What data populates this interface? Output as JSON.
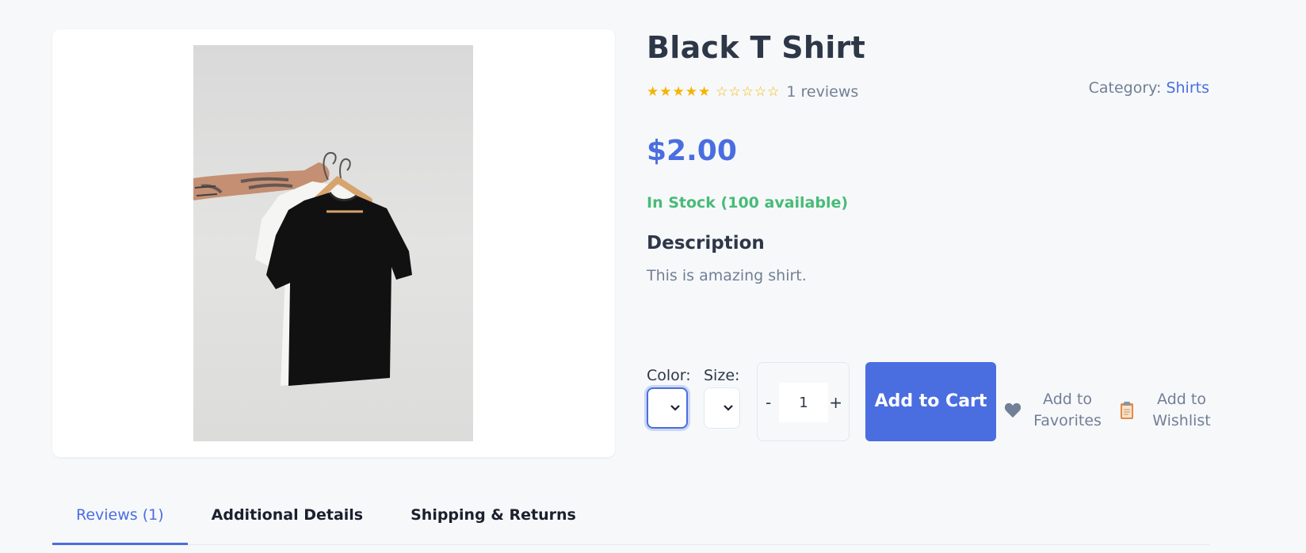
{
  "product": {
    "title": "Black T Shirt",
    "stars_filled": "★★★★★",
    "stars_empty": "☆☆☆☆☆",
    "rating_value": 5,
    "rating_max": 10,
    "reviews_text": "1 reviews",
    "category_label": "Category:",
    "category_value": "Shirts",
    "price": "$2.00",
    "stock": "In Stock (100 available)",
    "description_heading": "Description",
    "description": "This is amazing shirt."
  },
  "options": {
    "color_label": "Color:",
    "size_label": "Size:",
    "quantity_minus": "-",
    "quantity_value": "1",
    "quantity_plus": "+"
  },
  "actions": {
    "add_to_cart": "Add to Cart",
    "favorites_line1": "Add to",
    "favorites_line2": "Favorites",
    "wishlist_line1": "Add to",
    "wishlist_line2": "Wishlist"
  },
  "tabs": [
    {
      "label": "Reviews (1)",
      "active": true
    },
    {
      "label": "Additional Details",
      "active": false
    },
    {
      "label": "Shipping & Returns",
      "active": false
    }
  ],
  "colors": {
    "accent": "#4a6ee0",
    "stock_green": "#48bb78",
    "star_gold": "#f6b400",
    "muted_text": "#718096"
  },
  "icons": {
    "favorites": "heart-icon",
    "wishlist": "clipboard-icon",
    "dropdown": "chevron-down-icon"
  }
}
